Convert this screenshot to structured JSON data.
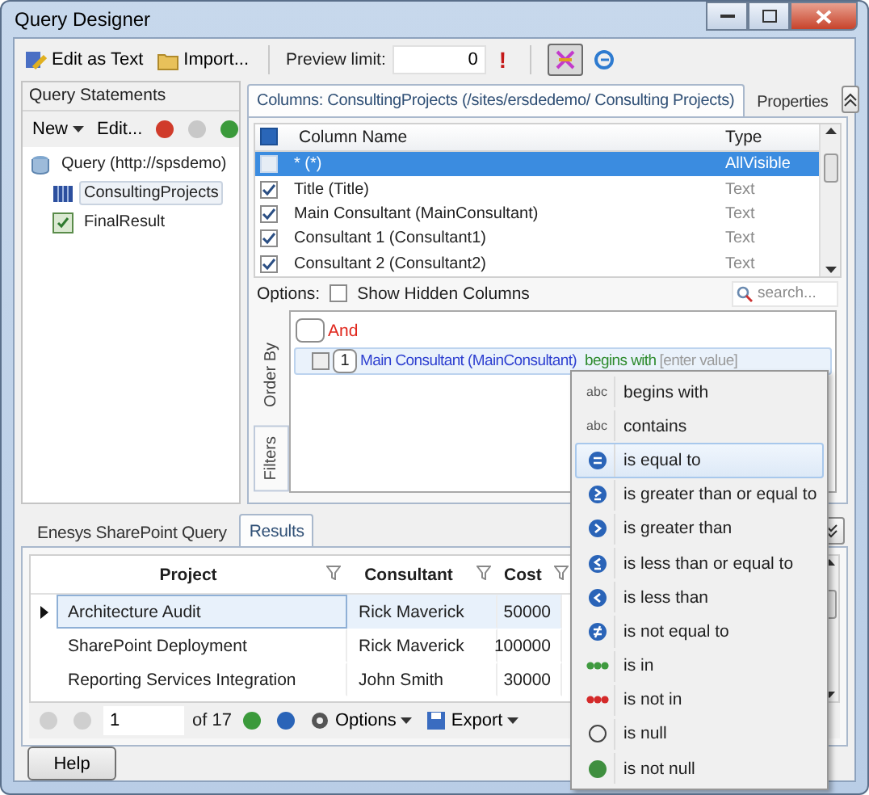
{
  "window": {
    "title": "Query Designer"
  },
  "toolbar": {
    "edit_as_text": "Edit as Text",
    "import": "Import...",
    "preview_label": "Preview limit:",
    "preview_value": "0",
    "warning": "!",
    "filter_toggle_pressed": true
  },
  "statements": {
    "title": "Query Statements",
    "new": "New",
    "edit": "Edit...",
    "tree": [
      {
        "label": "Query (http://spsdemo)",
        "children": [
          {
            "label": "ConsultingProjects",
            "selected": true
          },
          {
            "label": "FinalResult",
            "selected": false
          }
        ]
      }
    ]
  },
  "tabs": [
    {
      "label": "Columns: ConsultingProjects (/sites/ersdedemo/ Consulting Projects)",
      "selected": true
    },
    {
      "label": "Properties",
      "selected": false
    }
  ],
  "columns": {
    "headers": [
      "Column Name",
      "Type"
    ],
    "rows": [
      {
        "name": "* (*)",
        "type": "AllVisible",
        "checked": false,
        "selected": true
      },
      {
        "name": "Title (Title)",
        "type": "Text",
        "checked": true,
        "selected": false
      },
      {
        "name": "Main Consultant (MainConsultant)",
        "type": "Text",
        "checked": true,
        "selected": false
      },
      {
        "name": "Consultant 1 (Consultant1)",
        "type": "Text",
        "checked": true,
        "selected": false
      },
      {
        "name": "Consultant 2 (Consultant2)",
        "type": "Text",
        "checked": true,
        "selected": false
      }
    ]
  },
  "options": {
    "label": "Options:",
    "show_hidden": {
      "label": "Show Hidden Columns",
      "checked": false
    },
    "search_placeholder": "search..."
  },
  "filter": {
    "side_tabs": [
      {
        "label": "Order By",
        "selected": false
      },
      {
        "label": "Filters",
        "selected": true
      }
    ],
    "group": "And",
    "condition": {
      "checked": false,
      "index": "1",
      "field": "Main Consultant (MainConsultant)",
      "operator": "begins with",
      "value_placeholder": "[enter value]"
    }
  },
  "operator_menu": [
    {
      "label": "begins with",
      "kind": "abc",
      "badge": "abc",
      "selected": false
    },
    {
      "label": "contains",
      "kind": "abc",
      "badge": "abc",
      "selected": false
    },
    {
      "label": "is equal to",
      "kind": "eq",
      "selected": true
    },
    {
      "label": "is greater than or equal to",
      "kind": "ge",
      "selected": false
    },
    {
      "label": "is greater than",
      "kind": "gt",
      "selected": false
    },
    {
      "label": "is less than or equal to",
      "kind": "le",
      "selected": false
    },
    {
      "label": "is less than",
      "kind": "lt",
      "selected": false
    },
    {
      "label": "is not equal to",
      "kind": "ne",
      "selected": false
    },
    {
      "label": "is in",
      "kind": "in",
      "selected": false
    },
    {
      "label": "is not in",
      "kind": "notin",
      "selected": false
    },
    {
      "label": "is null",
      "kind": "null",
      "selected": false
    },
    {
      "label": "is not null",
      "kind": "notnull",
      "selected": false
    }
  ],
  "bottom_tabs": [
    {
      "label": "Enesys SharePoint Query",
      "selected": false
    },
    {
      "label": "Results",
      "selected": true
    }
  ],
  "results": {
    "columns": [
      "Project",
      "Consultant",
      "Cost"
    ],
    "rows": [
      {
        "cells": [
          "Architecture Audit",
          "Rick Maverick",
          "50000"
        ],
        "selected": true
      },
      {
        "cells": [
          "SharePoint Deployment",
          "Rick Maverick",
          "100000"
        ],
        "selected": false
      },
      {
        "cells": [
          "Reporting Services Integration",
          "John Smith",
          "30000"
        ],
        "selected": false
      }
    ]
  },
  "pager": {
    "page": "1",
    "of": "of 17",
    "options": "Options",
    "export": "Export"
  },
  "help": "Help"
}
